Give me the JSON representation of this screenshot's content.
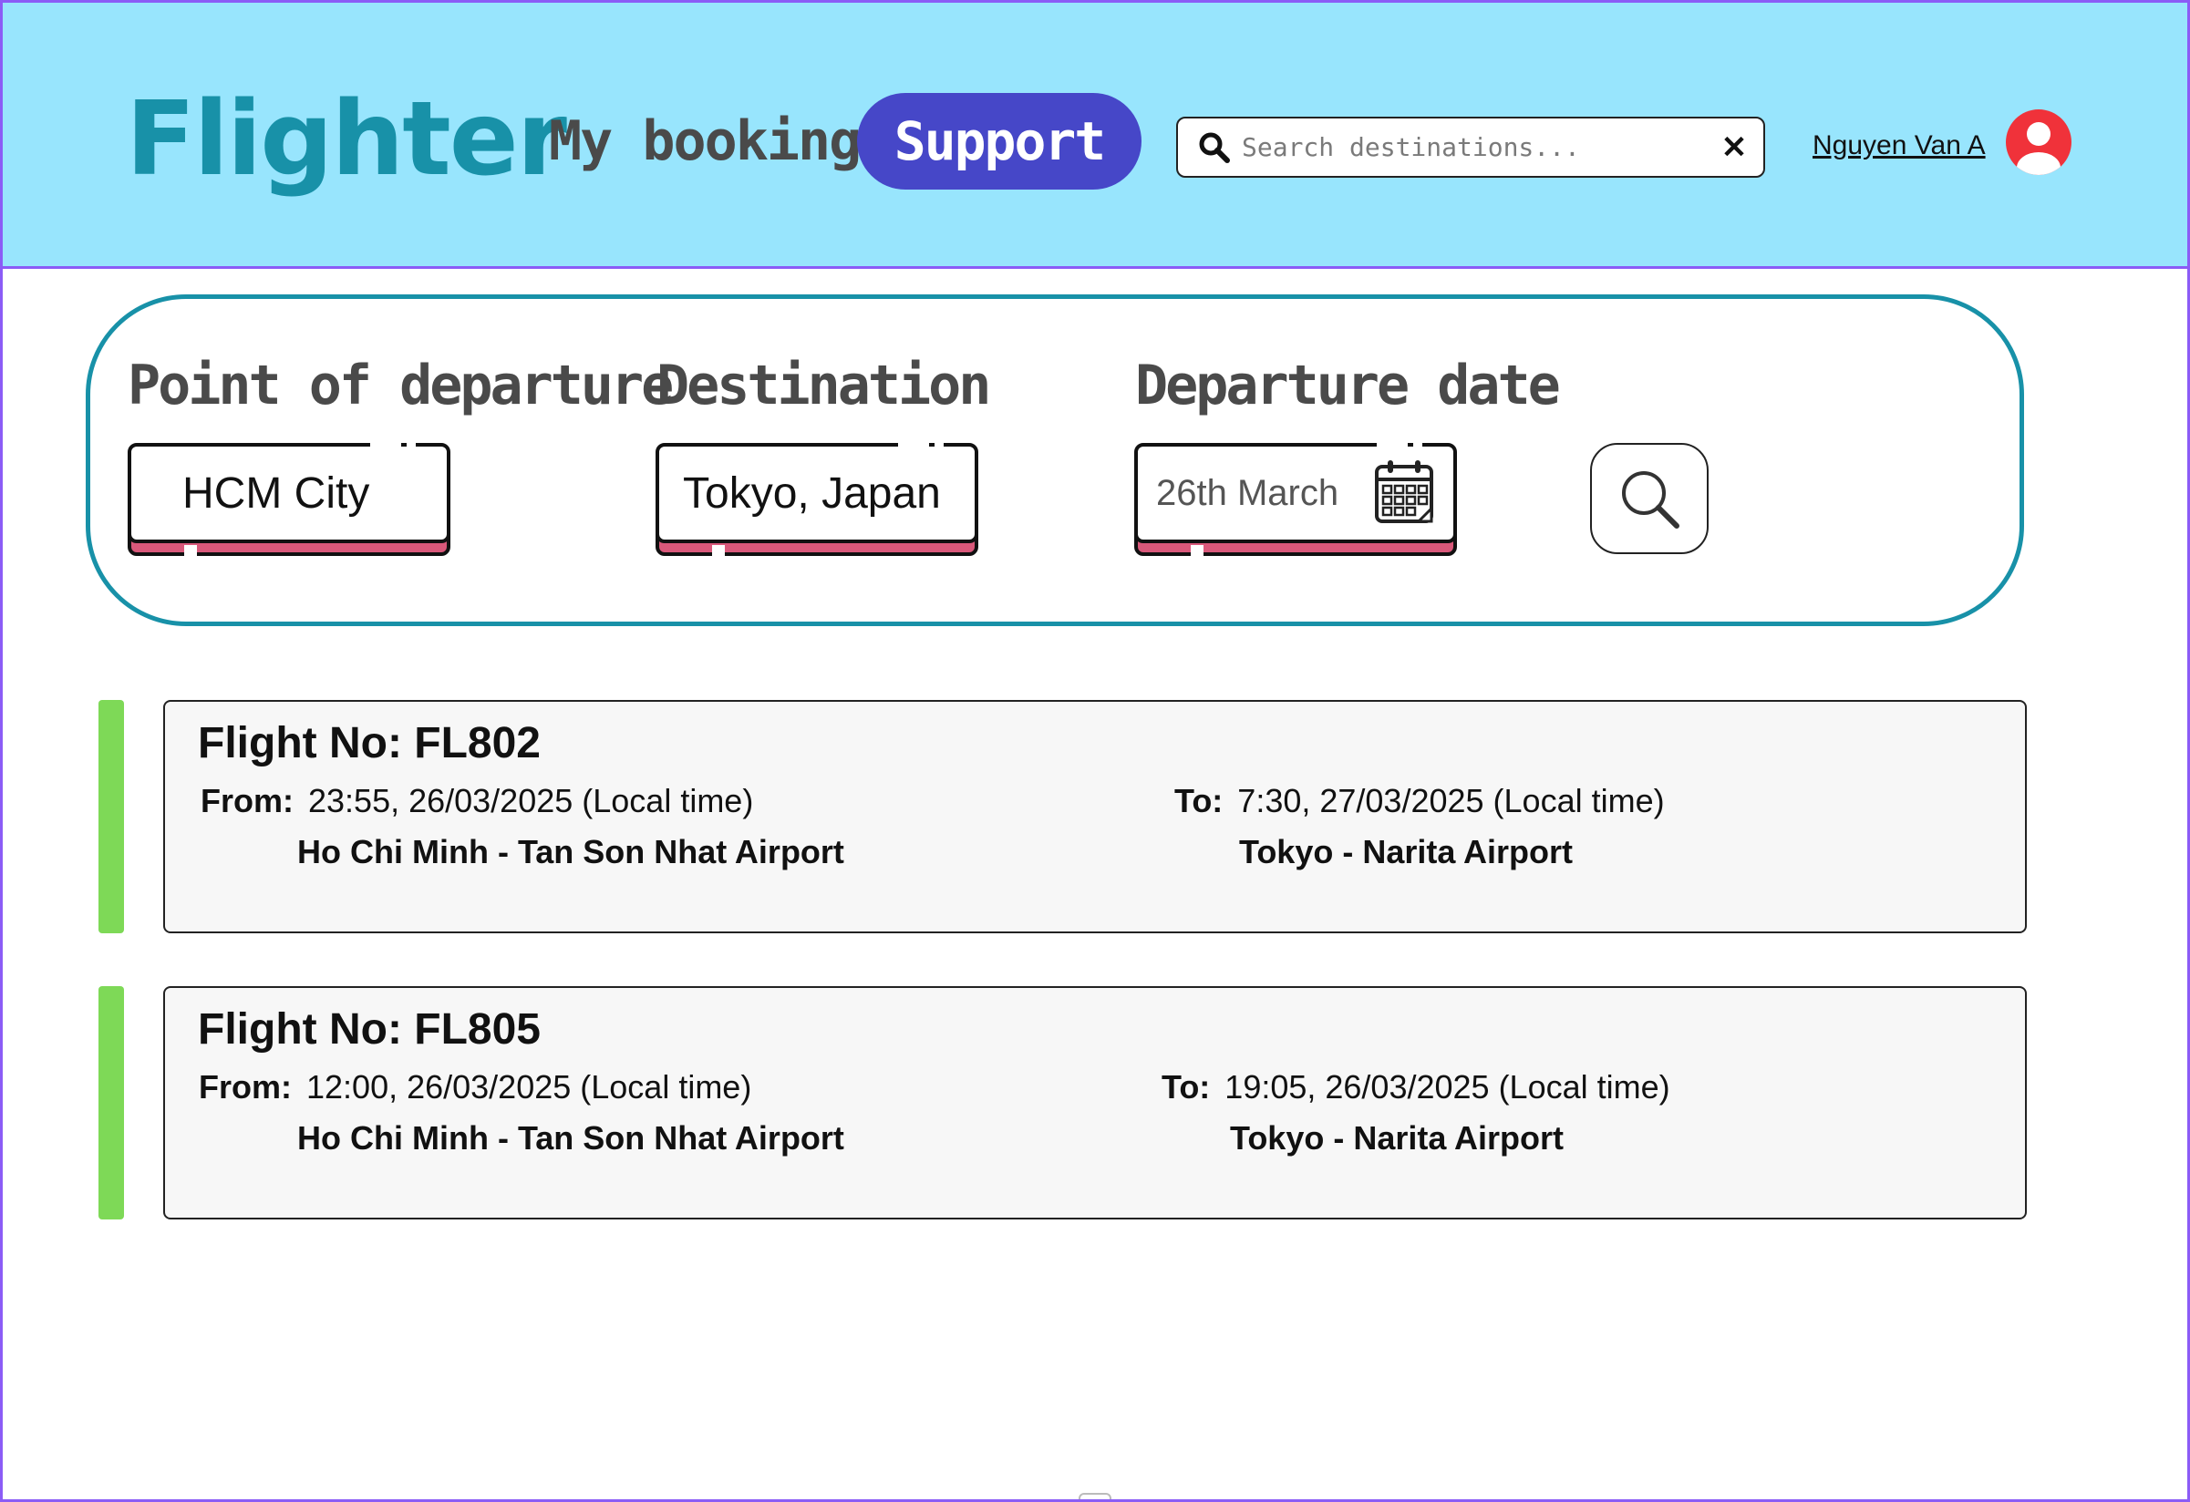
{
  "header": {
    "logo": "Flighter",
    "nav": {
      "booking": "My booking",
      "support": "Support"
    },
    "search": {
      "placeholder": "Search destinations...",
      "value": "",
      "clear_glyph": "✕"
    },
    "user": {
      "name": "Nguyen Van A"
    }
  },
  "search_form": {
    "departure": {
      "label": "Point of departure",
      "value": "HCM City"
    },
    "destination": {
      "label": "Destination",
      "value": "Tokyo, Japan"
    },
    "date": {
      "label": "Departure date",
      "value": "26th March",
      "icon": "calendar-icon"
    },
    "submit_icon": "search-icon"
  },
  "flights": [
    {
      "number_label": "Flight No: FL802",
      "from_label": "From:",
      "from_time": "23:55, 26/03/2025 (Local time)",
      "from_airport": "Ho Chi Minh - Tan Son Nhat Airport",
      "to_label": "To:",
      "to_time": "7:30, 27/03/2025 (Local time)",
      "to_airport": "Tokyo - Narita Airport"
    },
    {
      "number_label": "Flight No: FL805",
      "from_label": "From:",
      "from_time": "12:00, 26/03/2025 (Local time)",
      "from_airport": "Ho Chi Minh - Tan Son Nhat Airport",
      "to_label": "To:",
      "to_time": "19:05, 26/03/2025 (Local time)",
      "to_airport": "Tokyo - Narita Airport"
    }
  ],
  "colors": {
    "header_bg": "#98e5fd",
    "brand": "#1891a8",
    "support_button": "#4647c8",
    "status_accent": "#7ed957",
    "field_shadow": "#d9587a",
    "avatar": "#f0323a"
  }
}
